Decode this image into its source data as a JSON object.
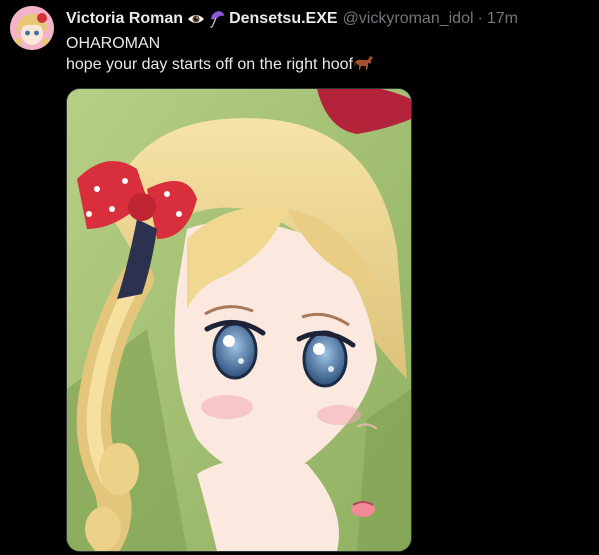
{
  "tweet": {
    "author": {
      "display_name": "Victoria Roman",
      "name_suffix": "Densetsu.EXE",
      "handle": "@vickyroman_idol",
      "separator": "·",
      "time": "17m",
      "emojis": [
        "eye-icon",
        "lightning-umbrella-icon"
      ]
    },
    "text_lines": [
      "OHAROMAN",
      "hope your day starts off on the right hoof"
    ],
    "trailing_emoji": "horse-icon",
    "media": {
      "description_icon": "anime-girl-image"
    }
  },
  "colors": {
    "background": "#000000",
    "text": "#e7e9ea",
    "secondary": "#71767b",
    "media_border": "#2f3336"
  }
}
